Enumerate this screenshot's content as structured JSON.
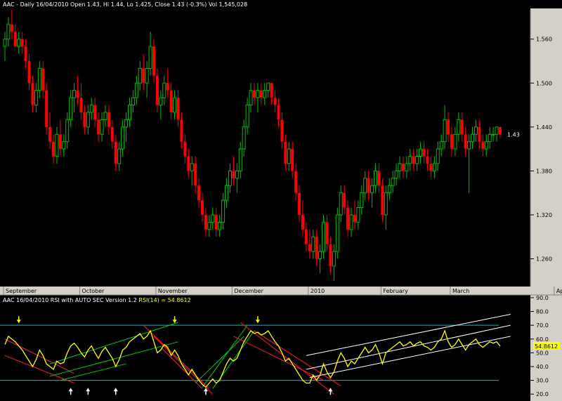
{
  "price_panel": {
    "header": "AAC - Daily 16/04/2010 Open 1.43, Hi 1.44, Lo 1.425, Close 1.43 (-0.3%) Vol 1,545,028",
    "last_label": "1.43"
  },
  "rsi_panel": {
    "header_prefix": "AAC 16/04/2010 RSI with AUTO SEC Version 1.2 ",
    "header_value": "RSI(14) = 54.8612",
    "last_label": "54.8612"
  },
  "colors": {
    "background": "#000000",
    "up_candle": "#00c000",
    "down_candle": "#ff0000",
    "rsi_line": "#ffff00",
    "axis_panel": "#d4d0c8",
    "level_line": "#00c0c0",
    "last_label_bg": "#ffff00"
  },
  "chart_data": [
    {
      "type": "candlestick",
      "title": "AAC - Daily 16/04/2010 Open 1.43, Hi 1.44, Lo 1.425, Close 1.43 (-0.3%) Vol 1,545,028",
      "ylim": [
        1.225,
        1.6
      ],
      "yticks": [
        "1.560",
        "1.500",
        "1.440",
        "1.380",
        "1.320",
        "1.260"
      ],
      "ytick_values": [
        1.56,
        1.5,
        1.44,
        1.38,
        1.32,
        1.26
      ],
      "x_labels": [
        "September",
        "October",
        "November",
        "December",
        "2010",
        "February",
        "March",
        "April"
      ],
      "x_label_index": [
        0,
        22,
        44,
        66,
        88,
        109,
        129,
        159
      ],
      "last_close": 1.43,
      "ohlc": [
        [
          1.55,
          1.57,
          1.53,
          1.56
        ],
        [
          1.56,
          1.59,
          1.55,
          1.58
        ],
        [
          1.58,
          1.6,
          1.56,
          1.57
        ],
        [
          1.57,
          1.58,
          1.55,
          1.55
        ],
        [
          1.55,
          1.57,
          1.54,
          1.56
        ],
        [
          1.56,
          1.57,
          1.54,
          1.55
        ],
        [
          1.55,
          1.56,
          1.52,
          1.53
        ],
        [
          1.53,
          1.54,
          1.49,
          1.5
        ],
        [
          1.5,
          1.51,
          1.46,
          1.47
        ],
        [
          1.47,
          1.5,
          1.46,
          1.49
        ],
        [
          1.49,
          1.53,
          1.48,
          1.52
        ],
        [
          1.52,
          1.53,
          1.48,
          1.49
        ],
        [
          1.49,
          1.5,
          1.43,
          1.44
        ],
        [
          1.44,
          1.46,
          1.41,
          1.42
        ],
        [
          1.42,
          1.43,
          1.39,
          1.4
        ],
        [
          1.4,
          1.44,
          1.39,
          1.43
        ],
        [
          1.43,
          1.45,
          1.4,
          1.41
        ],
        [
          1.41,
          1.43,
          1.4,
          1.42
        ],
        [
          1.42,
          1.46,
          1.41,
          1.45
        ],
        [
          1.45,
          1.49,
          1.44,
          1.48
        ],
        [
          1.48,
          1.5,
          1.46,
          1.49
        ],
        [
          1.49,
          1.51,
          1.47,
          1.48
        ],
        [
          1.48,
          1.5,
          1.45,
          1.46
        ],
        [
          1.46,
          1.47,
          1.43,
          1.44
        ],
        [
          1.44,
          1.47,
          1.43,
          1.46
        ],
        [
          1.46,
          1.48,
          1.45,
          1.47
        ],
        [
          1.47,
          1.48,
          1.44,
          1.45
        ],
        [
          1.45,
          1.46,
          1.42,
          1.43
        ],
        [
          1.43,
          1.46,
          1.42,
          1.45
        ],
        [
          1.45,
          1.47,
          1.44,
          1.46
        ],
        [
          1.46,
          1.47,
          1.43,
          1.44
        ],
        [
          1.44,
          1.45,
          1.41,
          1.42
        ],
        [
          1.42,
          1.43,
          1.38,
          1.39
        ],
        [
          1.39,
          1.42,
          1.38,
          1.41
        ],
        [
          1.41,
          1.45,
          1.4,
          1.44
        ],
        [
          1.44,
          1.46,
          1.42,
          1.45
        ],
        [
          1.45,
          1.48,
          1.44,
          1.47
        ],
        [
          1.47,
          1.49,
          1.46,
          1.48
        ],
        [
          1.48,
          1.51,
          1.47,
          1.5
        ],
        [
          1.5,
          1.53,
          1.49,
          1.52
        ],
        [
          1.52,
          1.54,
          1.49,
          1.5
        ],
        [
          1.5,
          1.53,
          1.48,
          1.52
        ],
        [
          1.52,
          1.57,
          1.51,
          1.55
        ],
        [
          1.55,
          1.56,
          1.5,
          1.51
        ],
        [
          1.51,
          1.52,
          1.46,
          1.47
        ],
        [
          1.47,
          1.49,
          1.45,
          1.48
        ],
        [
          1.48,
          1.51,
          1.47,
          1.5
        ],
        [
          1.5,
          1.52,
          1.48,
          1.49
        ],
        [
          1.49,
          1.5,
          1.45,
          1.46
        ],
        [
          1.46,
          1.49,
          1.45,
          1.48
        ],
        [
          1.48,
          1.49,
          1.44,
          1.45
        ],
        [
          1.45,
          1.46,
          1.41,
          1.42
        ],
        [
          1.42,
          1.43,
          1.39,
          1.4
        ],
        [
          1.4,
          1.41,
          1.37,
          1.38
        ],
        [
          1.38,
          1.4,
          1.36,
          1.39
        ],
        [
          1.39,
          1.4,
          1.35,
          1.36
        ],
        [
          1.36,
          1.37,
          1.33,
          1.34
        ],
        [
          1.34,
          1.35,
          1.31,
          1.32
        ],
        [
          1.32,
          1.33,
          1.29,
          1.3
        ],
        [
          1.3,
          1.32,
          1.29,
          1.31
        ],
        [
          1.31,
          1.33,
          1.3,
          1.32
        ],
        [
          1.32,
          1.33,
          1.29,
          1.3
        ],
        [
          1.3,
          1.32,
          1.29,
          1.31
        ],
        [
          1.31,
          1.35,
          1.3,
          1.34
        ],
        [
          1.34,
          1.37,
          1.33,
          1.36
        ],
        [
          1.36,
          1.39,
          1.35,
          1.38
        ],
        [
          1.38,
          1.4,
          1.36,
          1.37
        ],
        [
          1.37,
          1.39,
          1.35,
          1.38
        ],
        [
          1.38,
          1.42,
          1.37,
          1.41
        ],
        [
          1.41,
          1.45,
          1.4,
          1.44
        ],
        [
          1.44,
          1.48,
          1.43,
          1.47
        ],
        [
          1.47,
          1.5,
          1.46,
          1.49
        ],
        [
          1.49,
          1.5,
          1.47,
          1.48
        ],
        [
          1.48,
          1.5,
          1.46,
          1.49
        ],
        [
          1.49,
          1.5,
          1.47,
          1.48
        ],
        [
          1.48,
          1.5,
          1.47,
          1.49
        ],
        [
          1.49,
          1.5,
          1.48,
          1.5
        ],
        [
          1.5,
          1.5,
          1.47,
          1.48
        ],
        [
          1.48,
          1.49,
          1.46,
          1.47
        ],
        [
          1.47,
          1.48,
          1.44,
          1.45
        ],
        [
          1.45,
          1.46,
          1.41,
          1.42
        ],
        [
          1.42,
          1.43,
          1.38,
          1.39
        ],
        [
          1.39,
          1.42,
          1.38,
          1.41
        ],
        [
          1.41,
          1.42,
          1.37,
          1.38
        ],
        [
          1.38,
          1.39,
          1.34,
          1.35
        ],
        [
          1.35,
          1.36,
          1.31,
          1.32
        ],
        [
          1.32,
          1.34,
          1.29,
          1.3
        ],
        [
          1.3,
          1.31,
          1.27,
          1.28
        ],
        [
          1.28,
          1.3,
          1.26,
          1.27
        ],
        [
          1.27,
          1.3,
          1.26,
          1.29
        ],
        [
          1.29,
          1.3,
          1.25,
          1.26
        ],
        [
          1.26,
          1.28,
          1.24,
          1.27
        ],
        [
          1.27,
          1.32,
          1.26,
          1.31
        ],
        [
          1.31,
          1.32,
          1.27,
          1.28
        ],
        [
          1.28,
          1.29,
          1.24,
          1.25
        ],
        [
          1.25,
          1.28,
          1.23,
          1.27
        ],
        [
          1.27,
          1.33,
          1.26,
          1.32
        ],
        [
          1.32,
          1.36,
          1.31,
          1.35
        ],
        [
          1.35,
          1.36,
          1.32,
          1.33
        ],
        [
          1.33,
          1.34,
          1.29,
          1.3
        ],
        [
          1.3,
          1.33,
          1.29,
          1.32
        ],
        [
          1.32,
          1.34,
          1.3,
          1.31
        ],
        [
          1.31,
          1.34,
          1.3,
          1.33
        ],
        [
          1.33,
          1.36,
          1.32,
          1.35
        ],
        [
          1.35,
          1.38,
          1.34,
          1.37
        ],
        [
          1.37,
          1.38,
          1.34,
          1.35
        ],
        [
          1.35,
          1.37,
          1.33,
          1.36
        ],
        [
          1.36,
          1.39,
          1.35,
          1.38
        ],
        [
          1.38,
          1.39,
          1.35,
          1.36
        ],
        [
          1.36,
          1.37,
          1.31,
          1.32
        ],
        [
          1.32,
          1.36,
          1.3,
          1.35
        ],
        [
          1.35,
          1.37,
          1.34,
          1.36
        ],
        [
          1.36,
          1.38,
          1.35,
          1.37
        ],
        [
          1.37,
          1.39,
          1.36,
          1.38
        ],
        [
          1.38,
          1.4,
          1.37,
          1.39
        ],
        [
          1.39,
          1.4,
          1.37,
          1.38
        ],
        [
          1.38,
          1.4,
          1.37,
          1.39
        ],
        [
          1.39,
          1.41,
          1.38,
          1.4
        ],
        [
          1.4,
          1.41,
          1.38,
          1.39
        ],
        [
          1.39,
          1.41,
          1.38,
          1.4
        ],
        [
          1.4,
          1.42,
          1.39,
          1.41
        ],
        [
          1.41,
          1.42,
          1.39,
          1.4
        ],
        [
          1.4,
          1.41,
          1.38,
          1.39
        ],
        [
          1.39,
          1.4,
          1.37,
          1.38
        ],
        [
          1.38,
          1.4,
          1.37,
          1.39
        ],
        [
          1.39,
          1.42,
          1.38,
          1.41
        ],
        [
          1.41,
          1.43,
          1.4,
          1.42
        ],
        [
          1.42,
          1.47,
          1.41,
          1.45
        ],
        [
          1.45,
          1.46,
          1.42,
          1.43
        ],
        [
          1.43,
          1.44,
          1.4,
          1.41
        ],
        [
          1.41,
          1.44,
          1.4,
          1.43
        ],
        [
          1.43,
          1.46,
          1.42,
          1.45
        ],
        [
          1.45,
          1.46,
          1.42,
          1.43
        ],
        [
          1.43,
          1.44,
          1.4,
          1.41
        ],
        [
          1.41,
          1.43,
          1.35,
          1.42
        ],
        [
          1.42,
          1.44,
          1.41,
          1.43
        ],
        [
          1.43,
          1.45,
          1.42,
          1.44
        ],
        [
          1.44,
          1.45,
          1.41,
          1.42
        ],
        [
          1.42,
          1.43,
          1.4,
          1.41
        ],
        [
          1.41,
          1.43,
          1.4,
          1.42
        ],
        [
          1.42,
          1.44,
          1.41,
          1.43
        ],
        [
          1.43,
          1.44,
          1.42,
          1.43
        ],
        [
          1.43,
          1.44,
          1.42,
          1.44
        ],
        [
          1.44,
          1.44,
          1.425,
          1.43
        ]
      ]
    },
    {
      "type": "line",
      "title": "AAC 16/04/2010 RSI with AUTO SEC Version 1.2 RSI(14) = 54.8612",
      "series_label": "RSI(14)",
      "ylim": [
        15,
        92
      ],
      "yticks": [
        "90.0",
        "80.0",
        "70.0",
        "60.0",
        "50.0",
        "40.0",
        "30.0",
        "20.0"
      ],
      "ytick_values": [
        90,
        80,
        70,
        60,
        50,
        40,
        30,
        20
      ],
      "levels": [
        70,
        30
      ],
      "last_value": 54.8612,
      "values": [
        56,
        62,
        60,
        58,
        55,
        52,
        48,
        44,
        40,
        45,
        52,
        48,
        42,
        40,
        38,
        44,
        42,
        43,
        50,
        55,
        57,
        54,
        50,
        47,
        52,
        55,
        50,
        46,
        51,
        54,
        50,
        46,
        40,
        45,
        52,
        54,
        58,
        60,
        62,
        64,
        60,
        62,
        66,
        58,
        50,
        52,
        56,
        54,
        48,
        52,
        48,
        42,
        38,
        34,
        38,
        34,
        30,
        27,
        25,
        28,
        31,
        28,
        30,
        36,
        42,
        46,
        44,
        46,
        52,
        58,
        62,
        66,
        64,
        65,
        63,
        64,
        66,
        62,
        58,
        55,
        50,
        44,
        46,
        42,
        38,
        34,
        30,
        28,
        28,
        34,
        30,
        34,
        42,
        36,
        32,
        36,
        44,
        50,
        46,
        40,
        44,
        42,
        46,
        50,
        54,
        50,
        52,
        56,
        50,
        42,
        50,
        52,
        54,
        56,
        58,
        55,
        56,
        58,
        55,
        57,
        58,
        55,
        54,
        52,
        54,
        58,
        60,
        66,
        58,
        54,
        56,
        60,
        56,
        52,
        56,
        58,
        60,
        56,
        54,
        56,
        58,
        57,
        58,
        54.8612
      ]
    }
  ]
}
